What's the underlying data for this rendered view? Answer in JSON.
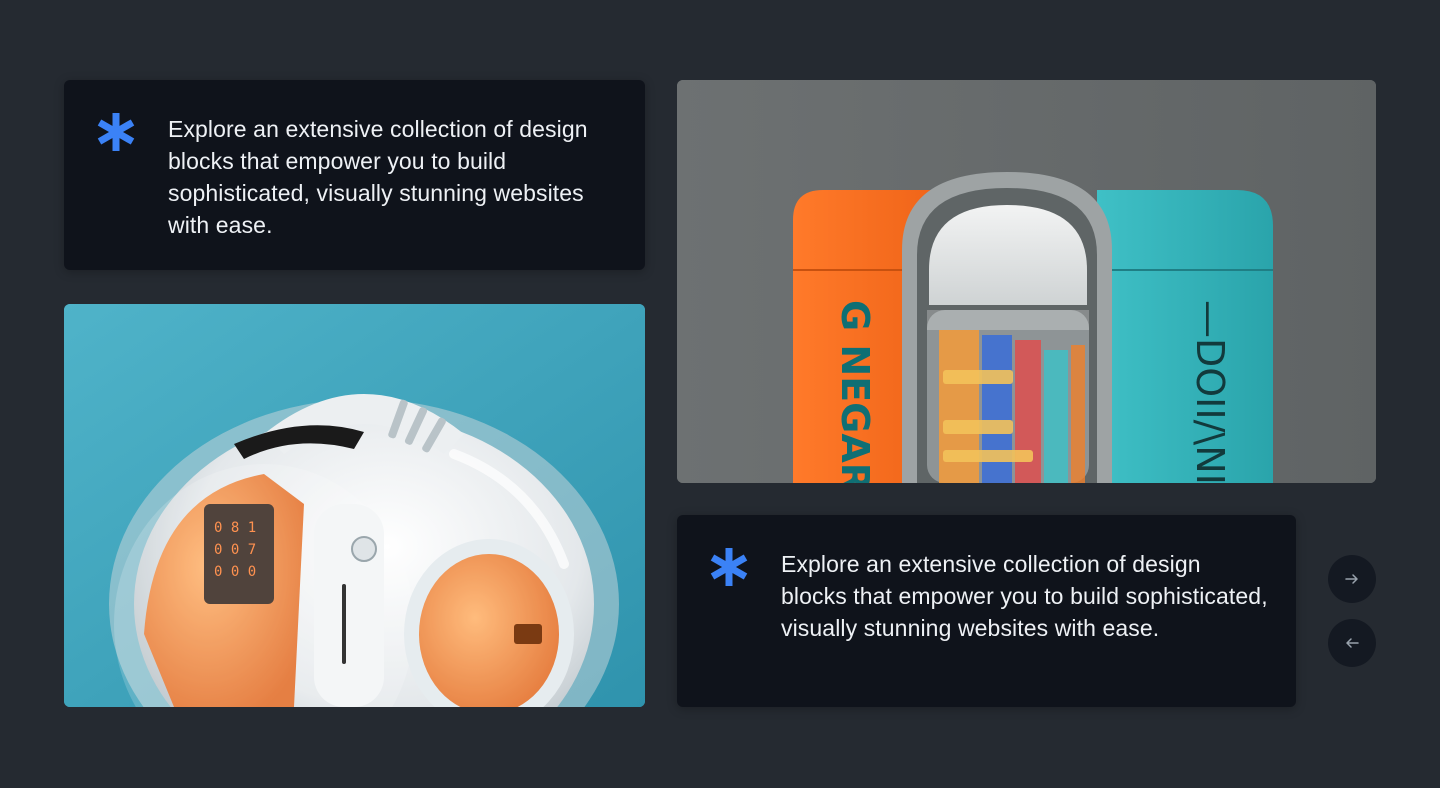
{
  "cards": [
    {
      "text": "Explore an extensive collection of design blocks that empower you to build sophisticated, visually stunning websites with ease.",
      "icon": "asterisk-icon"
    },
    {
      "text": "Explore an extensive collection of design blocks that empower you to build sophisticated, visually stunning websites with ease.",
      "icon": "asterisk-icon"
    }
  ],
  "images": {
    "left": {
      "subject": "robot-sphere-image"
    },
    "right": {
      "subject": "battery-capsules-image"
    }
  },
  "controls": {
    "next_icon": "arrow-right-icon",
    "prev_icon": "arrow-left-icon"
  },
  "colors": {
    "background": "#252a31",
    "card": "#0f131b",
    "accent": "#3b82f6",
    "text": "#eef1f5"
  }
}
